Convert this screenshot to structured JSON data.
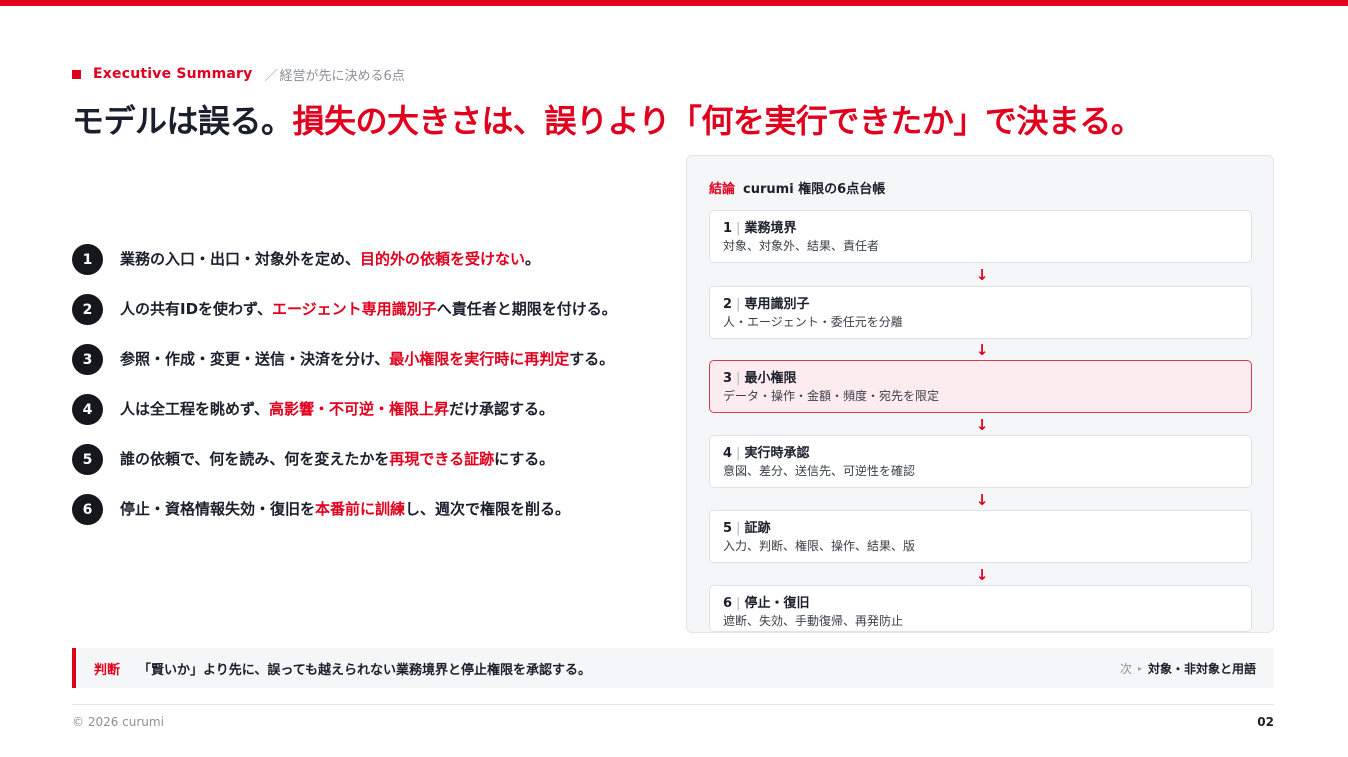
{
  "colors": {
    "accent": "#e0001e",
    "dark": "#15171c",
    "muted": "#8a9099"
  },
  "kicker": {
    "en": "Executive Summary",
    "sep": "／",
    "jp": "経営が先に決める6点"
  },
  "headline": {
    "part1": "モデルは誤る。",
    "part2": "損失の大きさは、誤りより「何を実行できたか」で決まる。"
  },
  "points": [
    {
      "num": "1",
      "pre": "業務の入口・出口・対象外を定め、",
      "em": "目的外の依頼を受けない",
      "post": "。"
    },
    {
      "num": "2",
      "pre": "人の共有IDを使わず、",
      "em": "エージェント専用識別子",
      "post": "へ責任者と期限を付ける。"
    },
    {
      "num": "3",
      "pre": "参照・作成・変更・送信・決済を分け、",
      "em": "最小権限を実行時に再判定",
      "post": "する。"
    },
    {
      "num": "4",
      "pre": "人は全工程を眺めず、",
      "em": "高影響・不可逆・権限上昇",
      "post": "だけ承認する。"
    },
    {
      "num": "5",
      "pre": "誰の依頼で、何を読み、何を変えたかを",
      "em": "再現できる証跡",
      "post": "にする。"
    },
    {
      "num": "6",
      "pre": "停止・資格情報失効・復旧を",
      "em": "本番前に訓練",
      "post": "し、週次で権限を削る。"
    }
  ],
  "panel": {
    "tag": "結論",
    "title": "curumi 権限の6点台帳",
    "arrow": "↓",
    "steps": [
      {
        "num": "1",
        "bar": "|",
        "title": "業務境界",
        "desc": "対象、対象外、結果、責任者"
      },
      {
        "num": "2",
        "bar": "|",
        "title": "専用識別子",
        "desc": "人・エージェント・委任元を分離"
      },
      {
        "num": "3",
        "bar": "|",
        "title": "最小権限",
        "desc": "データ・操作・金額・頻度・宛先を限定"
      },
      {
        "num": "4",
        "bar": "|",
        "title": "実行時承認",
        "desc": "意図、差分、送信先、可逆性を確認"
      },
      {
        "num": "5",
        "bar": "|",
        "title": "証跡",
        "desc": "入力、判断、権限、操作、結果、版"
      },
      {
        "num": "6",
        "bar": "|",
        "title": "停止・復旧",
        "desc": "遮断、失効、手動復帰、再発防止"
      }
    ]
  },
  "judgment": {
    "label": "判断",
    "text": "「賢いか」より先に、誤っても越えられない業務境界と停止権限を承認する。",
    "next_label": "次",
    "next_arrow": "▸",
    "next_text": "対象・非対象と用語"
  },
  "footer": {
    "copyright": "© 2026 curumi",
    "page": "02"
  }
}
